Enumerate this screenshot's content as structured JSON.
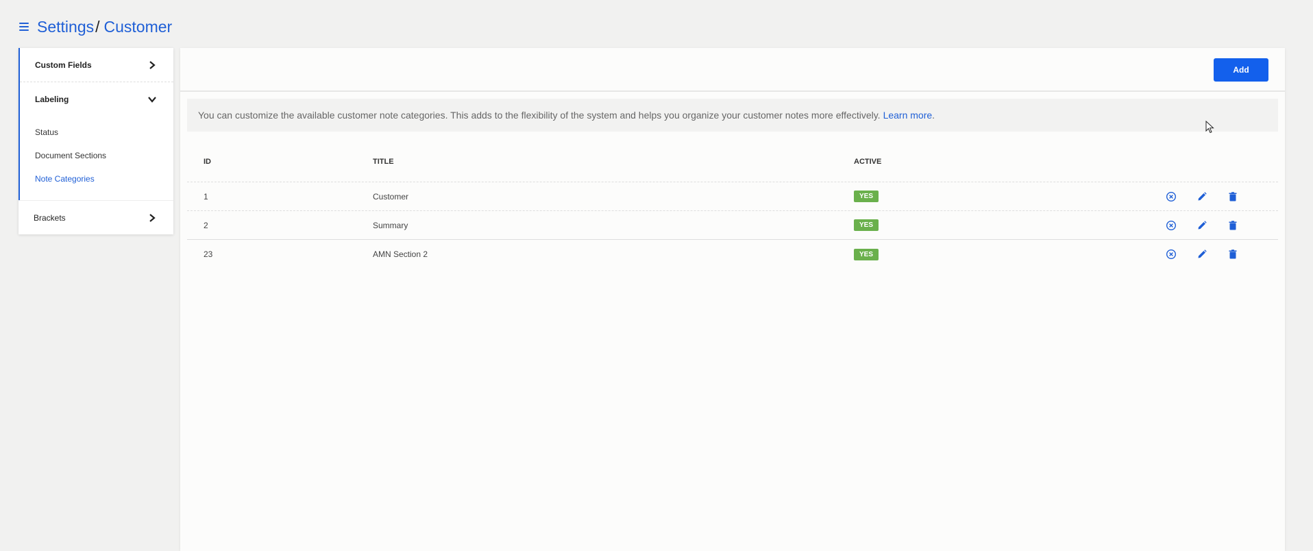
{
  "header": {
    "crumb_root": "Settings",
    "crumb_separator": "/",
    "crumb_current": "Customer"
  },
  "sidebar": {
    "custom_fields": "Custom Fields",
    "labeling": "Labeling",
    "labeling_items": [
      "Status",
      "Document Sections",
      "Note Categories"
    ],
    "brackets": "Brackets"
  },
  "toolbar": {
    "add_label": "Add"
  },
  "info": {
    "text": "You can customize the available customer note categories. This adds to the flexibility of the system and helps you organize your customer notes more effectively.",
    "link": "Learn more",
    "end": "."
  },
  "table": {
    "headers": {
      "id": "ID",
      "title": "TITLE",
      "active": "ACTIVE"
    },
    "rows": [
      {
        "id": "1",
        "title": "Customer",
        "active": "YES"
      },
      {
        "id": "2",
        "title": "Summary",
        "active": "YES"
      },
      {
        "id": "23",
        "title": "AMN Section 2",
        "active": "YES"
      }
    ]
  },
  "colors": {
    "accent": "#1f5fd6",
    "button": "#1360ec",
    "badge": "#6ab04c"
  },
  "icons": [
    "menu-icon",
    "chevron-right-icon",
    "chevron-down-icon",
    "cancel-circle-icon",
    "pencil-icon",
    "trash-icon"
  ]
}
